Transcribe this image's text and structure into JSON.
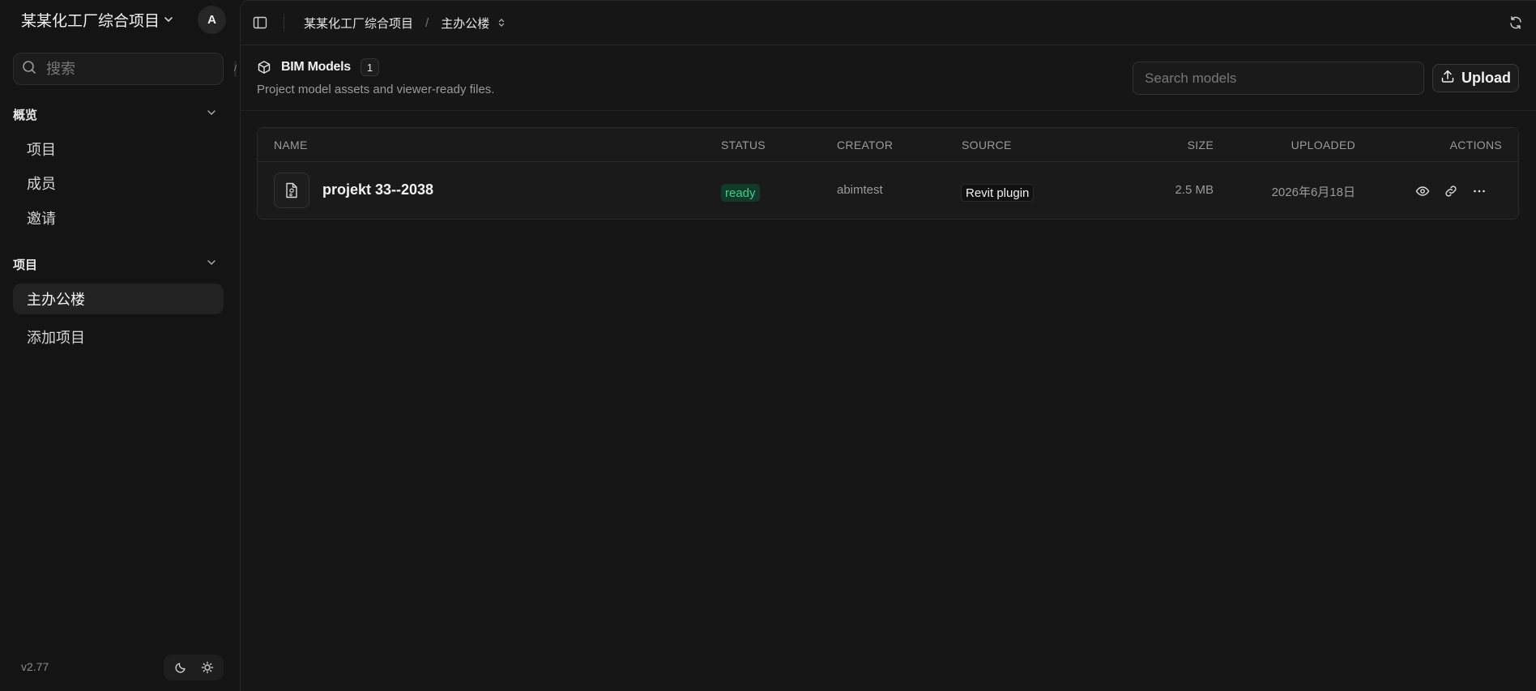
{
  "workspace": {
    "name": "某某化工厂综合项目",
    "avatar_letter": "A"
  },
  "sidebar": {
    "search": {
      "placeholder": "搜索",
      "shortcut": "/"
    },
    "sections": [
      {
        "title": "概览",
        "items": [
          {
            "label": "项目"
          },
          {
            "label": "成员"
          },
          {
            "label": "邀请"
          }
        ]
      },
      {
        "title": "项目",
        "items": [
          {
            "label": "主办公楼",
            "active": true
          },
          {
            "label": "添加项目"
          }
        ]
      }
    ],
    "version": "v2.77"
  },
  "topbar": {
    "breadcrumbs": [
      "某某化工厂综合项目",
      "主办公楼"
    ],
    "separator": "/"
  },
  "page": {
    "title": "BIM Models",
    "count": "1",
    "subtitle": "Project model assets and viewer-ready files.",
    "search_placeholder": "Search models",
    "upload_label": "Upload"
  },
  "table": {
    "columns": [
      "NAME",
      "STATUS",
      "CREATOR",
      "SOURCE",
      "SIZE",
      "UPLOADED",
      "ACTIONS"
    ],
    "rows": [
      {
        "name": "projekt 33--2038",
        "status": "ready",
        "creator": "abimtest",
        "source": "Revit plugin",
        "size": "2.5 MB",
        "uploaded": "2026年6月18日"
      }
    ]
  },
  "colors": {
    "background": "#141414",
    "panel": "#161616",
    "status_ready_bg": "#13392a",
    "status_ready_fg": "#3fcf86",
    "muted_text": "#9a9a9a"
  },
  "icons": {
    "workspace_chevron": "chevron-down-icon",
    "search": "search-icon",
    "section_toggle": "chevron-down-icon",
    "theme_dark": "moon-icon",
    "theme_light": "sun-icon",
    "sidebar_toggle": "panel-left-icon",
    "breadcrumb_switch": "chevrons-up-down-icon",
    "refresh": "refresh-icon",
    "title": "cube-icon",
    "upload": "upload-icon",
    "file": "file-model-icon",
    "view": "eye-icon",
    "link": "link-icon",
    "more": "more-horizontal-icon"
  }
}
